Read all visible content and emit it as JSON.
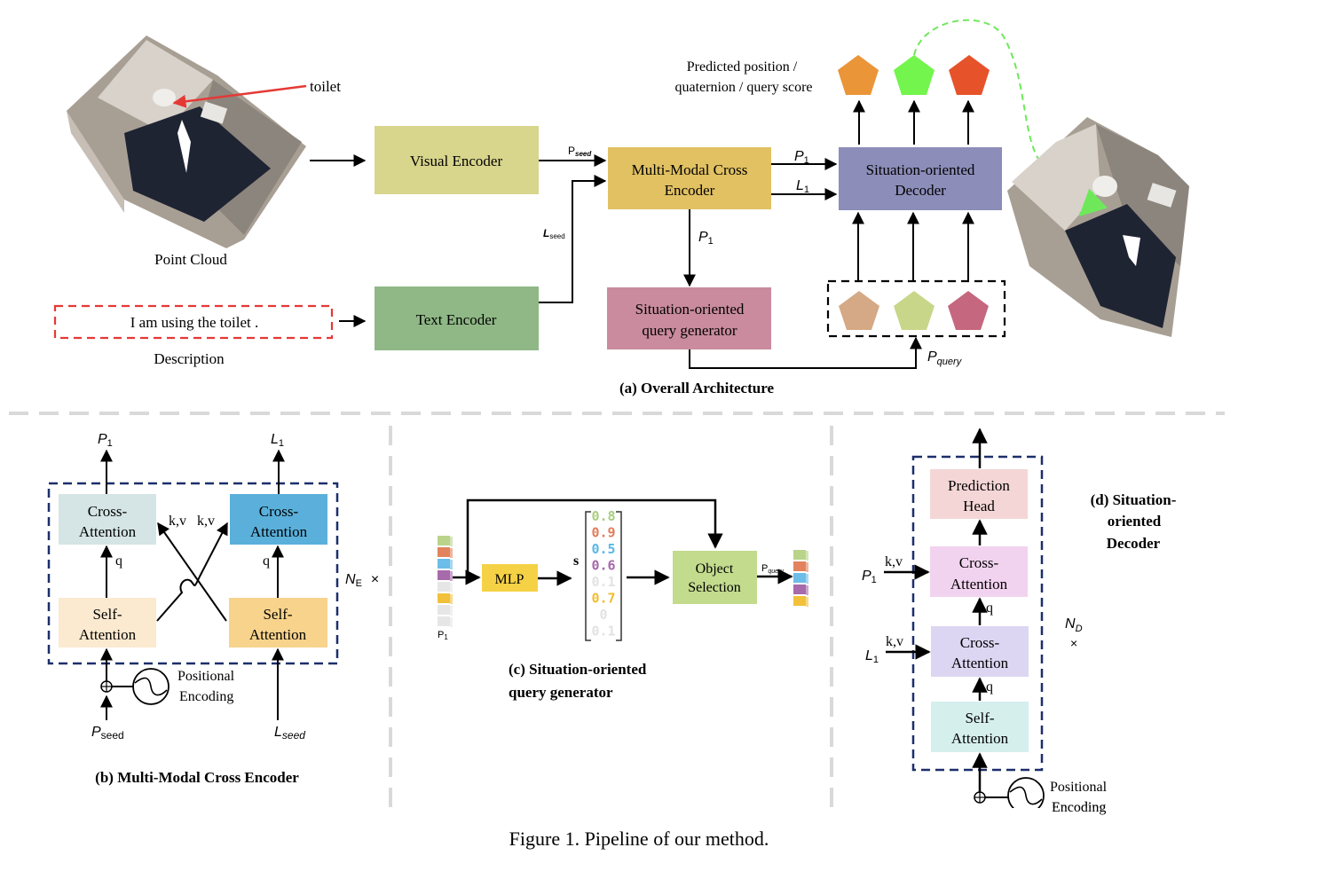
{
  "figure": {
    "caption": "Figure 1. Pipeline of our method."
  },
  "overall": {
    "title": "(a) Overall Architecture",
    "point_cloud_label": "Point Cloud",
    "toilet_label": "toilet",
    "description_text": "I am using the toilet .",
    "description_label": "Description",
    "visual_encoder": "Visual Encoder",
    "text_encoder": "Text Encoder",
    "cross_encoder": [
      "Multi-Modal Cross",
      "Encoder"
    ],
    "decoder": [
      "Situation-oriented",
      "Decoder"
    ],
    "query_generator": [
      "Situation-oriented",
      "query generator"
    ],
    "predicted_label": [
      "Predicted position /",
      "quaternion / query score"
    ],
    "p_seed": {
      "base": "P",
      "sub": "seed"
    },
    "l_seed": {
      "base": "L",
      "sub": "seed"
    },
    "p1": {
      "base": "P",
      "sub": "1"
    },
    "l1": {
      "base": "L",
      "sub": "1"
    },
    "p_query": {
      "base": "P",
      "sub": "query"
    },
    "colors": {
      "visual_encoder": "#d8d58c",
      "text_encoder": "#8fb886",
      "cross_encoder": "#e1c162",
      "decoder": "#8c8db9",
      "query_generator": "#c98b9d",
      "pred_orange": "#ea9538",
      "pred_green": "#73f54d",
      "pred_red": "#e6532a",
      "query_tan": "#d5a985",
      "query_lime": "#c8d689",
      "query_rose": "#c5677e",
      "desc_border": "#e53935",
      "toilet_arrow": "#e53935",
      "dashed_green": "#6ee85a"
    }
  },
  "encoder": {
    "title": "(b) Multi-Modal Cross Encoder",
    "cross_attention": [
      "Cross-",
      "Attention"
    ],
    "self_attention": [
      "Self-",
      "Attention"
    ],
    "kv": "k,v",
    "q": "q",
    "positional": [
      "Positional",
      "Encoding"
    ],
    "repeat": {
      "base": "N",
      "sub": "E",
      "suffix": "×"
    },
    "p1": {
      "base": "P",
      "sub": "1"
    },
    "l1": {
      "base": "L",
      "sub": "1"
    },
    "p_seed": {
      "base": "P",
      "sub": "seed"
    },
    "l_seed": {
      "base": "L",
      "sub": "seed"
    },
    "colors": {
      "cross_left": "#d5e4e4",
      "cross_right": "#5ab0db",
      "self_left": "#fbead0",
      "self_right": "#f7d38c",
      "frame": "#1c2f6b"
    }
  },
  "query_gen": {
    "title": [
      "(c) Situation-oriented",
      "query generator"
    ],
    "mlp": "MLP",
    "s_label": "s",
    "object_selection": [
      "Object",
      "Selection"
    ],
    "p1_label": {
      "base": "P",
      "sub": "1"
    },
    "p_query": {
      "base": "P",
      "sub": "query"
    },
    "scores": [
      {
        "value": "0.8",
        "color": "#a9cd7e"
      },
      {
        "value": "0.9",
        "color": "#e07c5a"
      },
      {
        "value": "0.5",
        "color": "#5ab8e6"
      },
      {
        "value": "0.6",
        "color": "#a668ad"
      },
      {
        "value": "0.1",
        "color": "#e2e2e2"
      },
      {
        "value": "0.7",
        "color": "#f1bd2e"
      },
      {
        "value": "0",
        "color": "#e2e2e2"
      },
      {
        "value": "0.1",
        "color": "#e2e2e2"
      }
    ],
    "input_cells": [
      "#b9d48a",
      "#e2835e",
      "#6cbde8",
      "#a76aaa",
      "#e6e6e6",
      "#f2c13a",
      "#e6e6e6",
      "#e6e6e6"
    ],
    "output_cells": [
      "#b9d48a",
      "#e2835e",
      "#6cbde8",
      "#a76aaa",
      "#f2c13a"
    ],
    "colors": {
      "mlp": "#f5d245",
      "object_selection": "#c3db8d"
    }
  },
  "decoder": {
    "title": [
      "(d) Situation-",
      "oriented",
      "Decoder"
    ],
    "prediction_head": [
      "Prediction",
      "Head"
    ],
    "cross_attention": [
      "Cross-",
      "Attention"
    ],
    "self_attention": [
      "Self-",
      "Attention"
    ],
    "kv": "k,v",
    "q": "q",
    "positional": [
      "Positional",
      "Encoding"
    ],
    "repeat": {
      "base": "N",
      "sub": "D",
      "suffix": "×"
    },
    "p1": {
      "base": "P",
      "sub": "1"
    },
    "l1": {
      "base": "L",
      "sub": "1"
    },
    "colors": {
      "prediction_head": "#f4d6d6",
      "cross_top": "#f2d3ef",
      "cross_bottom": "#dcd6f2",
      "self": "#d5efed",
      "frame": "#1c2f6b"
    }
  }
}
